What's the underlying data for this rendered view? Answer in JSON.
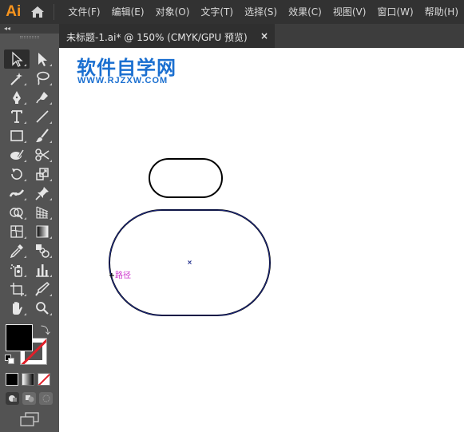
{
  "app": {
    "logo_text": "Ai",
    "accent_color": "#f7941e"
  },
  "menu": {
    "items": [
      {
        "label": "文件(F)"
      },
      {
        "label": "编辑(E)"
      },
      {
        "label": "对象(O)"
      },
      {
        "label": "文字(T)"
      },
      {
        "label": "选择(S)"
      },
      {
        "label": "效果(C)"
      },
      {
        "label": "视图(V)"
      },
      {
        "label": "窗口(W)"
      },
      {
        "label": "帮助(H)"
      }
    ]
  },
  "document_tab": {
    "label": "未标题-1.ai* @ 150% (CMYK/GPU 预览)",
    "close_glyph": "×"
  },
  "tools": {
    "collapse_glyph": "◂◂",
    "rows": [
      [
        "selection-tool",
        "direct-selection-tool"
      ],
      [
        "magic-wand-tool",
        "lasso-tool"
      ],
      [
        "pen-tool",
        "curvature-tool"
      ],
      [
        "type-tool",
        "line-segment-tool"
      ],
      [
        "rectangle-tool",
        "paintbrush-tool"
      ],
      [
        "shaper-tool",
        "scissors-tool"
      ],
      [
        "rotate-tool",
        "scale-tool"
      ],
      [
        "width-tool",
        "puppet-warp-tool"
      ],
      [
        "shape-builder-tool",
        "perspective-grid-tool"
      ],
      [
        "mesh-tool",
        "gradient-tool"
      ],
      [
        "eyedropper-tool",
        "blend-tool"
      ],
      [
        "symbol-sprayer-tool",
        "column-graph-tool"
      ],
      [
        "artboard-tool",
        "slice-tool"
      ],
      [
        "hand-tool",
        "zoom-tool"
      ]
    ],
    "fill_color": "#000000",
    "stroke_color": "none"
  },
  "canvas": {
    "watermark_title": "软件自学网",
    "watermark_url": "WWW.RJZXW.COM",
    "path_hint_label": "路径",
    "selection_color": "#1d2a8a"
  }
}
